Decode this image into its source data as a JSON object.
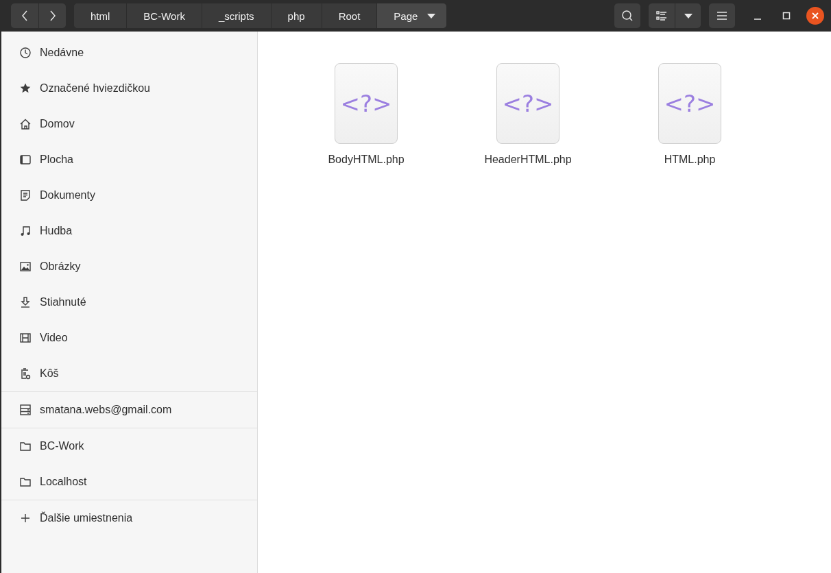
{
  "headerbar": {
    "breadcrumbs": [
      {
        "label": "html",
        "selected": false
      },
      {
        "label": "BC-Work",
        "selected": false
      },
      {
        "label": "_scripts",
        "selected": false
      },
      {
        "label": "php",
        "selected": false
      },
      {
        "label": "Root",
        "selected": false
      },
      {
        "label": "Page",
        "selected": true
      }
    ]
  },
  "sidebar": {
    "sections": [
      {
        "items": [
          {
            "label": "Nedávne"
          },
          {
            "label": "Označené hviezdičkou"
          },
          {
            "label": "Domov"
          },
          {
            "label": "Plocha"
          },
          {
            "label": "Dokumenty"
          },
          {
            "label": "Hudba"
          },
          {
            "label": "Obrázky"
          },
          {
            "label": "Stiahnuté"
          },
          {
            "label": "Video"
          },
          {
            "label": "Kôš"
          }
        ]
      },
      {
        "items": [
          {
            "label": "smatana.webs@gmail.com"
          }
        ]
      },
      {
        "items": [
          {
            "label": "BC-Work"
          },
          {
            "label": "Localhost"
          }
        ]
      },
      {
        "items": [
          {
            "label": "Ďalšie umiestnenia"
          }
        ]
      }
    ]
  },
  "files": [
    {
      "name": "BodyHTML.php",
      "glyph": "<?>"
    },
    {
      "name": "HeaderHTML.php",
      "glyph": "<?>"
    },
    {
      "name": "HTML.php",
      "glyph": "<?>"
    }
  ]
}
